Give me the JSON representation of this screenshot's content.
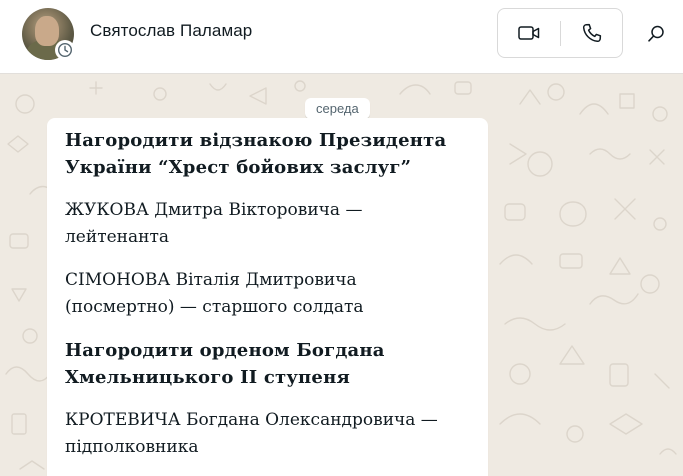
{
  "header": {
    "contact_name": "Святослав Паламар",
    "avatar_icon": "avatar-photo",
    "status_icon": "status-clock-icon",
    "video_call_icon": "video-camera-icon",
    "voice_call_icon": "phone-icon",
    "search_icon": "search-icon"
  },
  "chat": {
    "date_separator": "середа",
    "message": {
      "heading_1": "Нагородити відзнакою Президента України “Хрест бойових заслуг”",
      "entry_1": "ЖУКОВА Дмитра Вікторовича — лейтенанта",
      "entry_2": "СІМОНОВА Віталія Дмитровича (посмертно) — старшого солдата",
      "heading_2": "Нагородити орденом Богдана Хмельницького ІІ ступеня",
      "entry_3": "КРОТЕВИЧА Богдана Олександровича — підполковника"
    }
  },
  "colors": {
    "header_bg": "#ffffff",
    "chat_bg": "#efeae2",
    "bubble_bg": "#ffffff",
    "text_primary": "#111b21",
    "text_secondary": "#54656f"
  }
}
